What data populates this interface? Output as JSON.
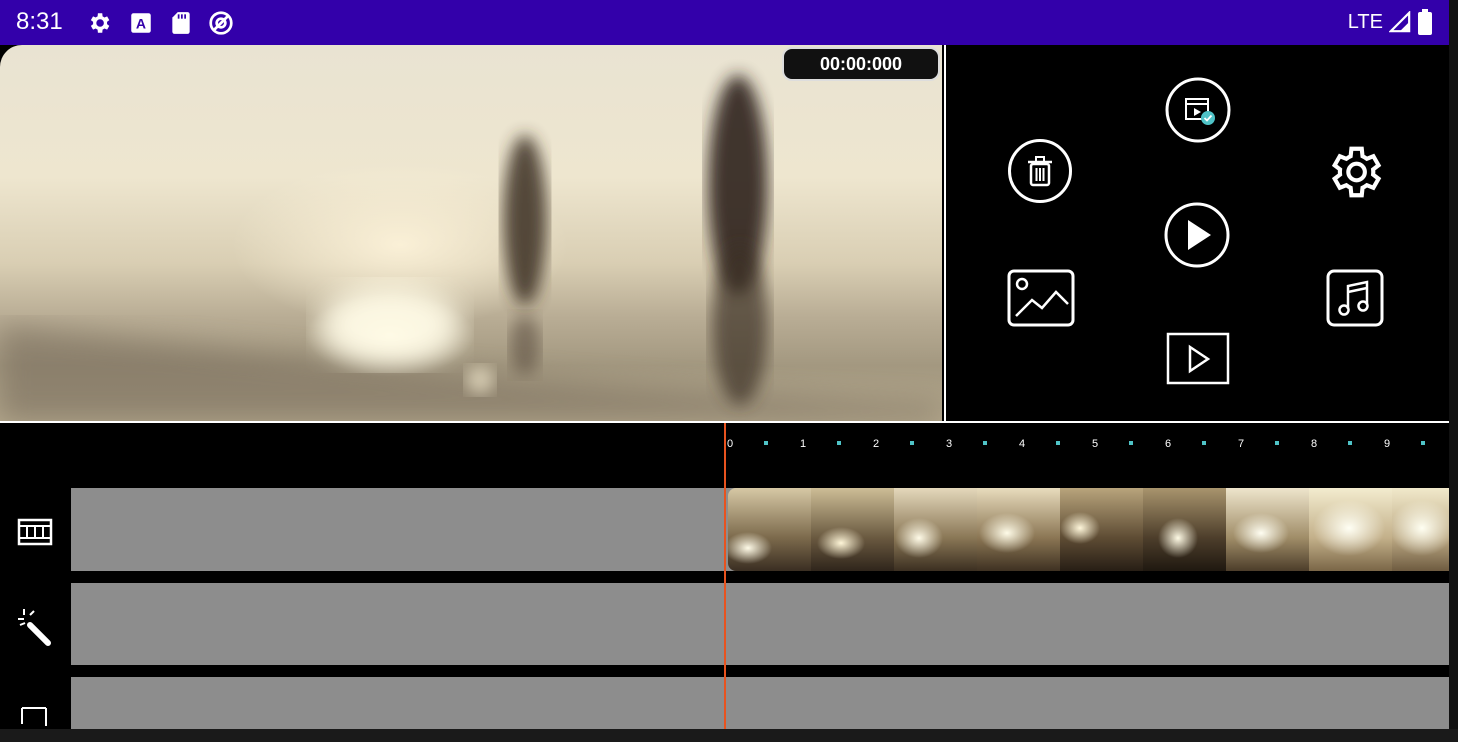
{
  "status_bar": {
    "time": "8:31",
    "icons_left": [
      "gear-icon",
      "a-badge-icon",
      "sd-card-icon",
      "dnd-icon"
    ],
    "network": "LTE",
    "icons_right": [
      "signal-icon",
      "battery-icon"
    ]
  },
  "preview": {
    "timecode": "00:00:000"
  },
  "controls": {
    "items": [
      "export-icon",
      "delete-icon",
      "settings-icon",
      "play-icon",
      "add-image-icon",
      "add-music-icon",
      "preview-play-icon"
    ]
  },
  "timeline": {
    "ruler_labels": [
      "0",
      "1",
      "2",
      "3",
      "4",
      "5",
      "6",
      "7",
      "8",
      "9"
    ],
    "tracks": [
      {
        "name": "video",
        "icon": "film-strip-icon"
      },
      {
        "name": "effects",
        "icon": "magic-wand-icon"
      },
      {
        "name": "text",
        "icon": "text-frame-icon"
      }
    ],
    "thumbnail_count": 9
  },
  "colors": {
    "status_bar": "#3300aa",
    "playhead": "#e8531f",
    "track": "#8d8d8d",
    "ruler_dot": "#4fc3c7"
  }
}
